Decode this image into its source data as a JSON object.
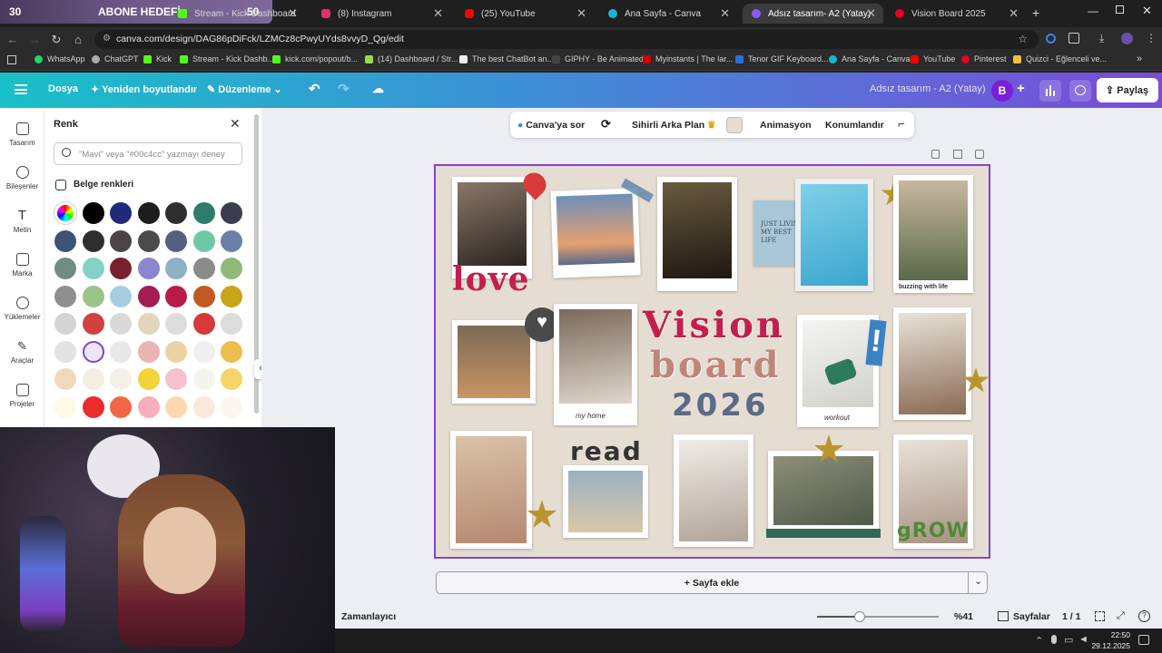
{
  "overlay": {
    "count": "30",
    "label": "ABONE HEDEFİ",
    "value": "50"
  },
  "tabs": [
    {
      "title": "Stream - Kick Dashboard"
    },
    {
      "title": "(8) Instagram"
    },
    {
      "title": "(25) YouTube"
    },
    {
      "title": "Ana Sayfa - Canva"
    },
    {
      "title": "Adsız tasarım- A2 (Yatay)"
    },
    {
      "title": "Vision Board 2025"
    }
  ],
  "url": "canva.com/design/DAG86pDiFck/LZMCz8cPwyUYds8vvyD_Qg/edit",
  "bookmarks": [
    "WhatsApp",
    "ChatGPT",
    "Kick",
    "Stream - Kick Dashb...",
    "kick.com/popout/b...",
    "(14) Dashboard / Str...",
    "The best ChatBot an...",
    "GIPHY - Be Animated",
    "Myinstants | The lar...",
    "Tenor GIF Keyboard...",
    "Ana Sayfa - Canva",
    "YouTube",
    "Pinterest",
    "Quizci - Eğlenceli ve..."
  ],
  "header": {
    "file": "Dosya",
    "resize": "Yeniden boyutlandır",
    "edit": "Düzenleme",
    "doc_title": "Adsız tasarım - A2 (Yatay)",
    "avatar": "B",
    "share": "Paylaş"
  },
  "rail": [
    "Tasarım",
    "Bileşenler",
    "Metin",
    "Marka",
    "Yüklemeler",
    "Araçlar",
    "Projeler"
  ],
  "panel": {
    "title": "Renk",
    "search_placeholder": "\"Mavi\" veya \"#00c4cc\" yazmayı deney",
    "doc_colors_label": "Belge renkleri",
    "swatches": [
      [
        "#000000",
        "#1f2a7a",
        "#1d1d1d",
        "#2f2f2f",
        "#2e7d6a",
        "#3a3d4f"
      ],
      [
        "#3c5576",
        "#2f2f2f",
        "#4a4448",
        "#4b4b4b",
        "#556080",
        "#6fc8a4",
        "#6b80a8"
      ],
      [
        "#6f8c80",
        "#86d1c6",
        "#7a1f2e",
        "#8a86cf",
        "#8db2c6",
        "#8b8b8b",
        "#8fba78"
      ],
      [
        "#8f8f8f",
        "#9bc48a",
        "#a5cde0",
        "#a51c52",
        "#b91c47",
        "#c05a22",
        "#c8a418"
      ],
      [
        "#d4d4d4",
        "#d34040",
        "#d9d9d9",
        "#e1d5bb",
        "#dcdcdc",
        "#d63a3a",
        "#dcdcdc"
      ],
      [
        "#e2e2e2",
        "#ece8f3",
        "#e8e8e8",
        "#ebb3b3",
        "#ecd2a5",
        "#efefef",
        "#eebd4f"
      ],
      [
        "#f0d9ba",
        "#f3eee0",
        "#f4f0e6",
        "#f2d338",
        "#f6c1cf",
        "#f4f4ee",
        "#f4d56a"
      ],
      [
        "#fbfbe6",
        "#ec2b2b",
        "#f16745",
        "#f7aebd",
        "#fbd8b0",
        "#fbe7dc",
        "#fdf6ee"
      ]
    ]
  },
  "toolbar": {
    "ask": "Canva'ya sor",
    "magic_bg": "Sihirli Arka Plan",
    "animation": "Animasyon",
    "position": "Konumlandır"
  },
  "board": {
    "words": {
      "love": "love",
      "vision": "Vision",
      "board": "board",
      "year": "2026",
      "read": "read",
      "grow": "gROW",
      "exclaim": "!"
    },
    "captions": {
      "living": "JUST LIVING MY BEST LIFE",
      "buzzing": "buzzing with life",
      "home": "my home",
      "workout": "workout"
    }
  },
  "add_page": "+ Sayfa ekle",
  "footer": {
    "timer": "Zamanlayıcı",
    "zoom": "%41",
    "zoom_level": 0.35,
    "pages": "Sayfalar",
    "page_count": "1 / 1"
  },
  "taskbar": {
    "time": "22:50",
    "date": "29.12.2025"
  }
}
